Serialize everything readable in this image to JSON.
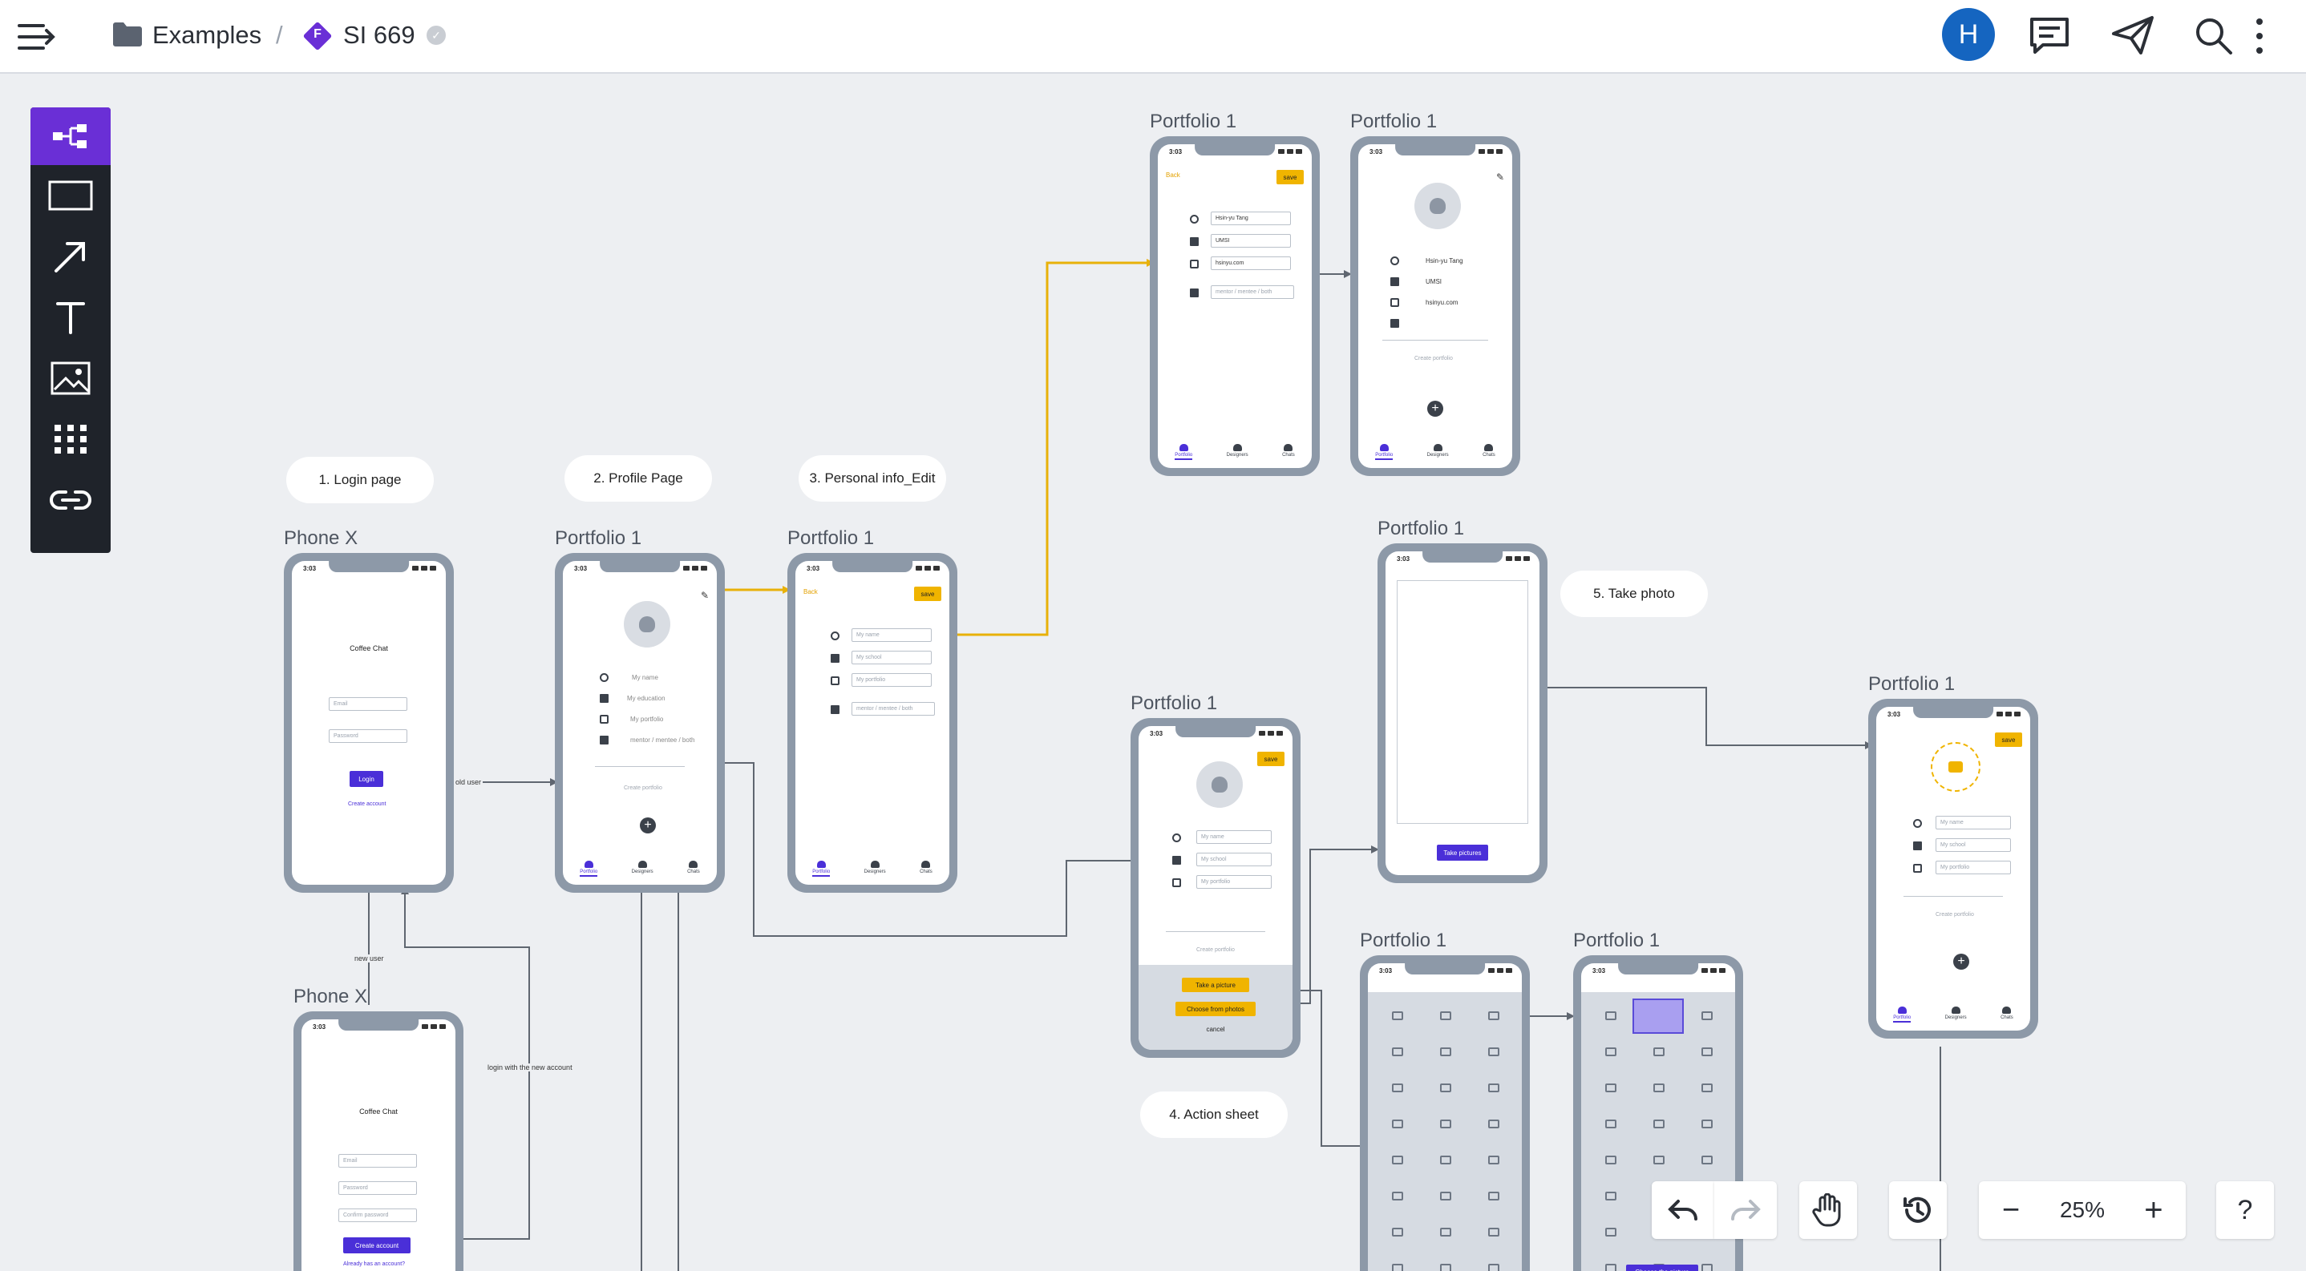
{
  "header": {
    "folder": "Examples",
    "separator": "/",
    "file_badge": "F",
    "file_name": "SI 669",
    "avatar_letter": "H",
    "colors": {
      "badge": "#6a2fd6",
      "avatar": "#1565c0"
    }
  },
  "toolbar_icons": [
    "flow-icon",
    "rectangle-icon",
    "arrow-icon",
    "text-icon",
    "image-icon",
    "components-icon",
    "link-icon"
  ],
  "stickies": {
    "login": "1. Login page",
    "profile": "2. Profile Page",
    "personal": "3. Personal info_Edit",
    "photo": "5. Take photo",
    "action": "4. Action sheet"
  },
  "frames": {
    "phone_x": "Phone X",
    "portfolio": "Portfolio 1"
  },
  "edge_labels": {
    "old_user": "old user",
    "new_user": "new user",
    "login_new": "login with the new account"
  },
  "phone": {
    "time": "3:03",
    "app_title": "Coffee Chat",
    "email": "Email",
    "password": "Password",
    "confirm_password": "Confirm password",
    "login": "Login",
    "create_account_link": "Create account",
    "create_account_button": "Create account",
    "already_account": "Already has an account?"
  },
  "profile": {
    "name": "My name",
    "education": "My education",
    "portfolio": "My portfolio",
    "mentor": "mentor / mentee / both",
    "create_portfolio": "Create portfolio",
    "school": "My school",
    "plus": "+"
  },
  "edit": {
    "back": "Back",
    "save": "save"
  },
  "filled": {
    "name": "Hsin-yu Tang",
    "school": "UMSI",
    "site": "hsinyu.com"
  },
  "tabs": {
    "portfolio": "Portfolio",
    "designers": "Designers",
    "chats": "Chats"
  },
  "action_sheet": {
    "take": "Take a picture",
    "choose": "Choose from photos",
    "cancel": "cancel"
  },
  "camera": {
    "take_pictures": "Take pictures"
  },
  "gallery": {
    "choose_picture": "Choose the picture"
  },
  "zoom": {
    "minus": "−",
    "value": "25%",
    "plus": "+",
    "help": "?"
  }
}
